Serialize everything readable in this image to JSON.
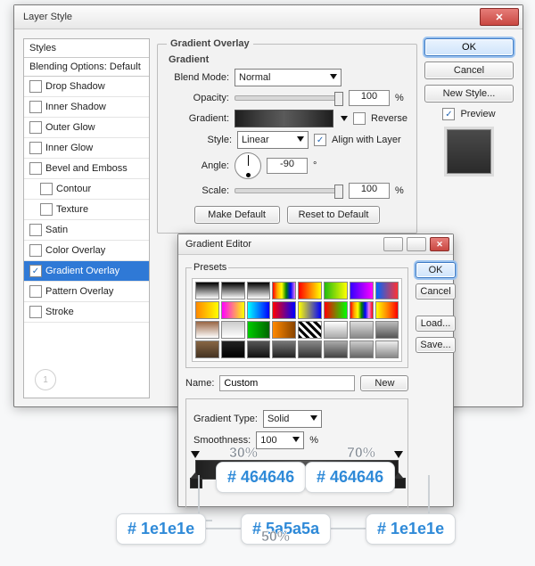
{
  "window": {
    "title": "Layer Style"
  },
  "sidebar": {
    "styles_header": "Styles",
    "blending_header": "Blending Options: Default",
    "items": [
      {
        "label": "Drop Shadow",
        "checked": false
      },
      {
        "label": "Inner Shadow",
        "checked": false
      },
      {
        "label": "Outer Glow",
        "checked": false
      },
      {
        "label": "Inner Glow",
        "checked": false
      },
      {
        "label": "Bevel and Emboss",
        "checked": false
      },
      {
        "label": "Contour",
        "checked": false,
        "indent": true
      },
      {
        "label": "Texture",
        "checked": false,
        "indent": true
      },
      {
        "label": "Satin",
        "checked": false
      },
      {
        "label": "Color Overlay",
        "checked": false
      },
      {
        "label": "Gradient Overlay",
        "checked": true,
        "active": true
      },
      {
        "label": "Pattern Overlay",
        "checked": false
      },
      {
        "label": "Stroke",
        "checked": false
      }
    ],
    "step_badge": "1"
  },
  "overlay": {
    "group_title": "Gradient Overlay",
    "subtitle": "Gradient",
    "labels": {
      "blend_mode": "Blend Mode:",
      "opacity": "Opacity:",
      "gradient": "Gradient:",
      "style": "Style:",
      "angle": "Angle:",
      "scale": "Scale:",
      "reverse": "Reverse",
      "align": "Align with Layer",
      "percent": "%",
      "degree": "°"
    },
    "blend_mode_value": "Normal",
    "opacity_value": "100",
    "reverse_checked": false,
    "style_value": "Linear",
    "align_checked": true,
    "angle_value": "-90",
    "scale_value": "100",
    "buttons": {
      "make_default": "Make Default",
      "reset_default": "Reset to Default"
    }
  },
  "right": {
    "ok": "OK",
    "cancel": "Cancel",
    "new_style": "New Style...",
    "preview_label": "Preview",
    "preview_checked": true
  },
  "editor": {
    "title": "Gradient Editor",
    "presets_label": "Presets",
    "name_label": "Name:",
    "name_value": "Custom",
    "new_btn": "New",
    "ok": "OK",
    "cancel": "Cancel",
    "load": "Load...",
    "save": "Save...",
    "gtype_label": "Gradient Type:",
    "gtype_value": "Solid",
    "smoothness_label": "Smoothness:",
    "smoothness_value": "100",
    "percent": "%"
  },
  "annotations": {
    "p30": "30%",
    "p50": "50%",
    "p70": "70%",
    "c1": "# 1e1e1e",
    "c2": "# 464646",
    "c3": "# 5a5a5a",
    "c4": "# 464646",
    "c5": "# 1e1e1e"
  }
}
